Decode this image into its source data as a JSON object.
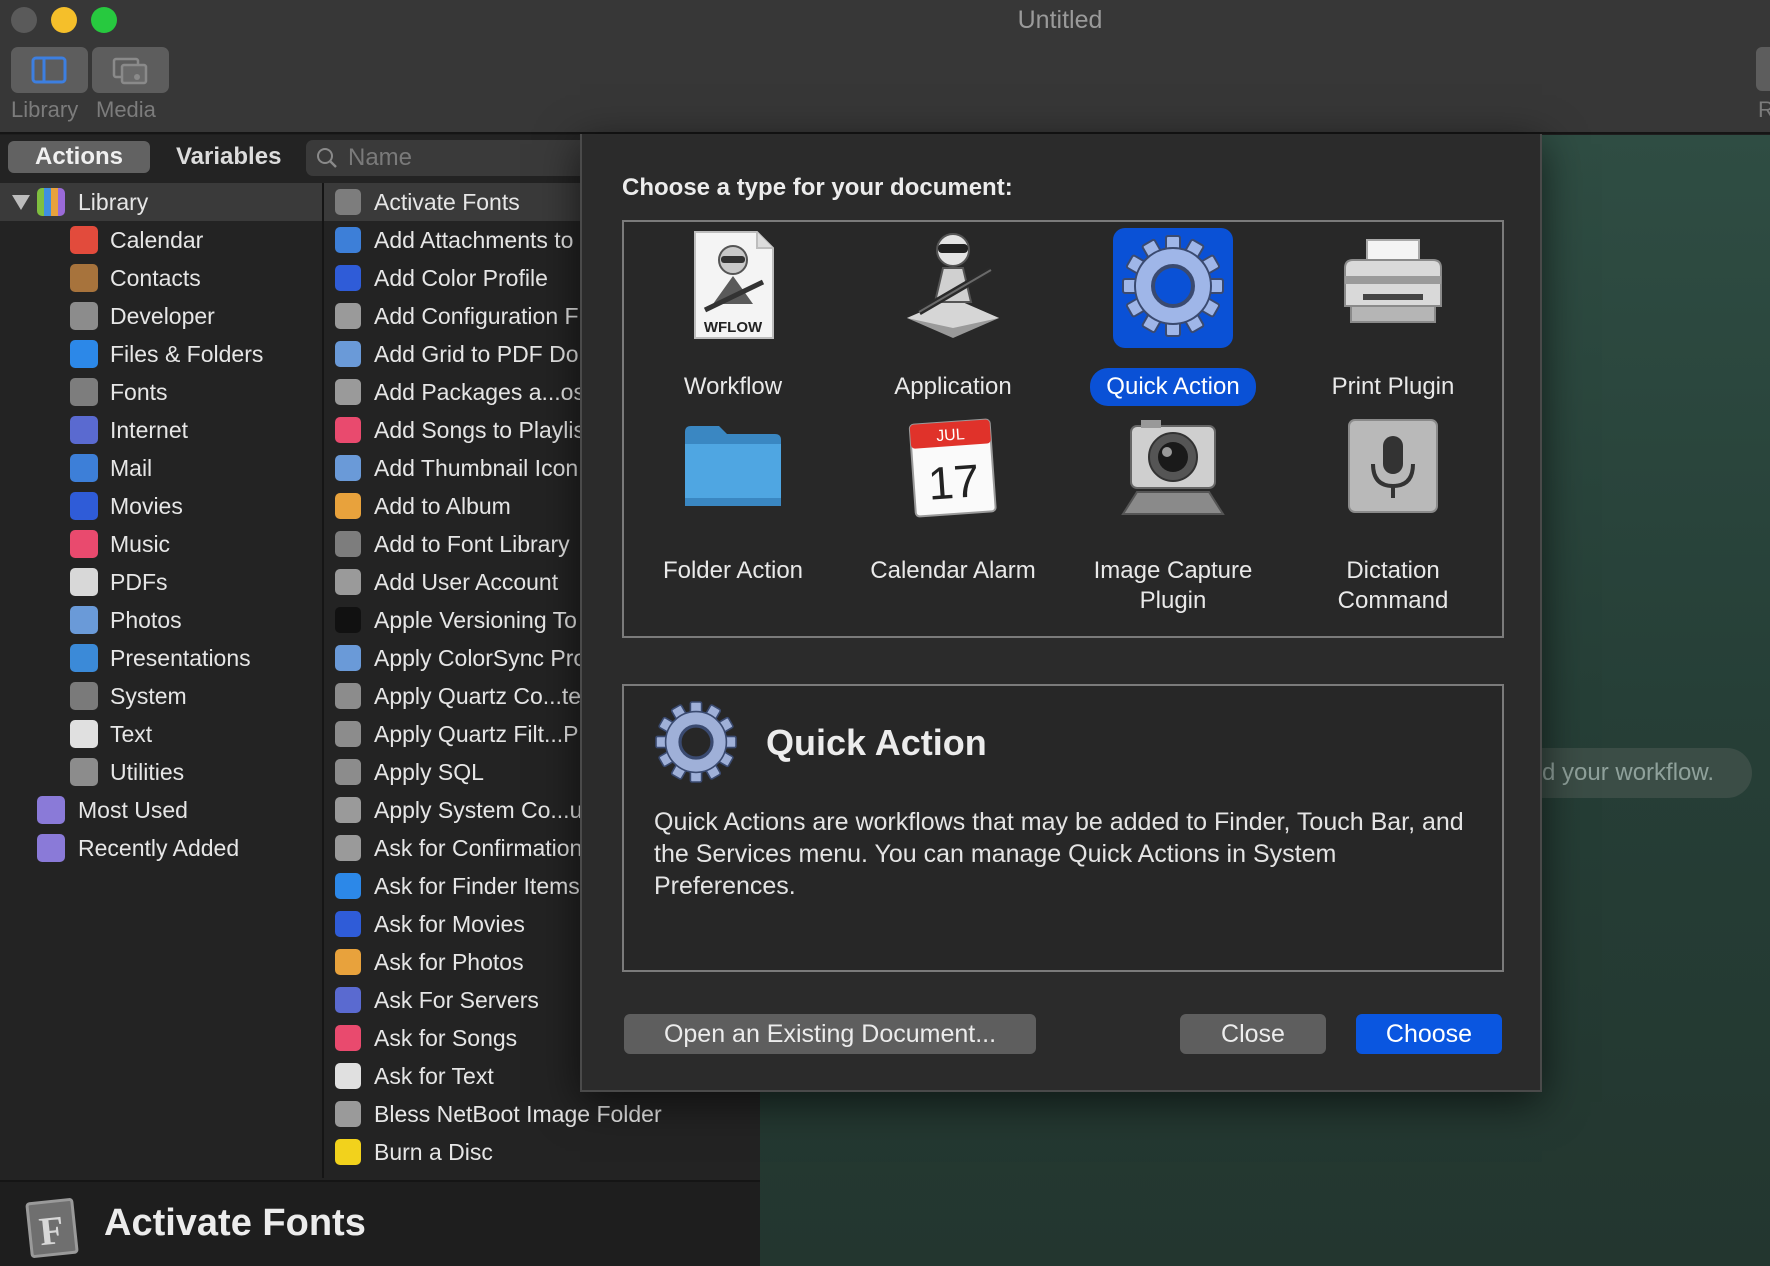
{
  "window": {
    "title": "Untitled"
  },
  "toolbar": {
    "library_label": "Library",
    "media_label": "Media",
    "right_label": "R"
  },
  "library": {
    "tabs": [
      {
        "label": "Actions",
        "active": true
      },
      {
        "label": "Variables",
        "active": false
      }
    ],
    "search": {
      "placeholder": "Name",
      "value": ""
    },
    "root": {
      "label": "Library",
      "expanded": true,
      "icon": "library-books-icon"
    },
    "categories": [
      {
        "label": "Calendar",
        "icon": "calendar-icon",
        "color": "#e24b3c"
      },
      {
        "label": "Contacts",
        "icon": "contacts-icon",
        "color": "#a7733c"
      },
      {
        "label": "Developer",
        "icon": "developer-tools-icon",
        "color": "#8c8c8c"
      },
      {
        "label": "Files & Folders",
        "icon": "finder-icon",
        "color": "#2c88e8"
      },
      {
        "label": "Fonts",
        "icon": "font-book-icon",
        "color": "#7d7d7d"
      },
      {
        "label": "Internet",
        "icon": "globe-icon",
        "color": "#5a6ad0"
      },
      {
        "label": "Mail",
        "icon": "mail-icon",
        "color": "#3d7fd8"
      },
      {
        "label": "Movies",
        "icon": "movies-icon",
        "color": "#2f5cd8"
      },
      {
        "label": "Music",
        "icon": "music-icon",
        "color": "#e94a6e"
      },
      {
        "label": "PDFs",
        "icon": "pdf-icon",
        "color": "#d8d8d8"
      },
      {
        "label": "Photos",
        "icon": "photos-icon",
        "color": "#6a9ad8"
      },
      {
        "label": "Presentations",
        "icon": "keynote-icon",
        "color": "#3b8ad8"
      },
      {
        "label": "System",
        "icon": "system-icon",
        "color": "#7a7a7a"
      },
      {
        "label": "Text",
        "icon": "text-icon",
        "color": "#e0e0e0"
      },
      {
        "label": "Utilities",
        "icon": "utilities-icon",
        "color": "#8c8c8c"
      }
    ],
    "top_level": [
      {
        "label": "Most Used",
        "icon": "smart-folder-icon",
        "color": "#8a7ad8"
      },
      {
        "label": "Recently Added",
        "icon": "smart-folder-icon",
        "color": "#8a7ad8"
      }
    ],
    "actions": [
      {
        "label": "Activate Fonts",
        "icon": "font-book-icon",
        "color": "#7d7d7d",
        "selected": true
      },
      {
        "label": "Add Attachments to",
        "icon": "mail-icon",
        "color": "#3d7fd8"
      },
      {
        "label": "Add Color Profile",
        "icon": "colorsync-icon",
        "color": "#2f5cd8"
      },
      {
        "label": "Add Configuration F",
        "icon": "automator-icon",
        "color": "#9a9a9a"
      },
      {
        "label": "Add Grid to PDF Do",
        "icon": "preview-icon",
        "color": "#6a9ad8"
      },
      {
        "label": "Add Packages a...os",
        "icon": "automator-icon",
        "color": "#9a9a9a"
      },
      {
        "label": "Add Songs to Playlis",
        "icon": "music-icon",
        "color": "#e94a6e"
      },
      {
        "label": "Add Thumbnail Icon",
        "icon": "preview-icon",
        "color": "#6a9ad8"
      },
      {
        "label": "Add to Album",
        "icon": "photos-icon",
        "color": "#e8a23c"
      },
      {
        "label": "Add to Font Library",
        "icon": "font-book-icon",
        "color": "#7d7d7d"
      },
      {
        "label": "Add User Account",
        "icon": "automator-icon",
        "color": "#9a9a9a"
      },
      {
        "label": "Apple Versioning To",
        "icon": "terminal-icon",
        "color": "#111111"
      },
      {
        "label": "Apply ColorSync Pro",
        "icon": "preview-icon",
        "color": "#6a9ad8"
      },
      {
        "label": "Apply Quartz Co...te",
        "icon": "developer-tools-icon",
        "color": "#8c8c8c"
      },
      {
        "label": "Apply Quartz Filt...P",
        "icon": "developer-tools-icon",
        "color": "#8c8c8c"
      },
      {
        "label": "Apply SQL",
        "icon": "developer-tools-icon",
        "color": "#8c8c8c"
      },
      {
        "label": "Apply System Co...u",
        "icon": "automator-icon",
        "color": "#9a9a9a"
      },
      {
        "label": "Ask for Confirmation",
        "icon": "automator-robot-icon",
        "color": "#9a9a9a"
      },
      {
        "label": "Ask for Finder Items",
        "icon": "finder-icon",
        "color": "#2c88e8"
      },
      {
        "label": "Ask for Movies",
        "icon": "movies-icon",
        "color": "#2f5cd8"
      },
      {
        "label": "Ask for Photos",
        "icon": "photos-icon",
        "color": "#e8a23c"
      },
      {
        "label": "Ask For Servers",
        "icon": "globe-icon",
        "color": "#5a6ad0"
      },
      {
        "label": "Ask for Songs",
        "icon": "music-icon",
        "color": "#e94a6e"
      },
      {
        "label": "Ask for Text",
        "icon": "text-icon",
        "color": "#e0e0e0"
      },
      {
        "label": "Bless NetBoot Image Folder",
        "icon": "automator-icon",
        "color": "#9a9a9a"
      },
      {
        "label": "Burn a Disc",
        "icon": "burn-icon",
        "color": "#f2d21c"
      }
    ],
    "detail": {
      "title": "Activate Fonts",
      "icon": "font-book-icon"
    }
  },
  "canvas": {
    "hint": "d your workflow."
  },
  "dialog": {
    "heading": "Choose a type for your document:",
    "types": [
      {
        "label": "Workflow",
        "icon": "workflow-document-icon",
        "icon_text": "WFLOW",
        "selected": false
      },
      {
        "label": "Application",
        "icon": "automator-robot-icon",
        "selected": false
      },
      {
        "label": "Quick Action",
        "icon": "gear-icon",
        "selected": true
      },
      {
        "label": "Print Plugin",
        "icon": "printer-icon",
        "selected": false
      },
      {
        "label": "Folder Action",
        "icon": "folder-icon",
        "selected": false
      },
      {
        "label": "Calendar Alarm",
        "icon": "calendar-icon",
        "icon_month": "JUL",
        "icon_day": "17",
        "selected": false
      },
      {
        "label": "Image Capture\nPlugin",
        "icon": "camera-icon",
        "selected": false
      },
      {
        "label": "Dictation\nCommand",
        "icon": "microphone-icon",
        "selected": false
      }
    ],
    "description": {
      "title": "Quick Action",
      "icon": "gear-icon",
      "text": "Quick Actions are workflows that may be added to Finder, Touch Bar, and the Services menu. You can manage Quick Actions in System Preferences."
    },
    "buttons": {
      "open": "Open an Existing Document...",
      "close": "Close",
      "choose": "Choose"
    },
    "colors": {
      "accent": "#0a51d6",
      "primary_button": "#0a56e0"
    }
  }
}
